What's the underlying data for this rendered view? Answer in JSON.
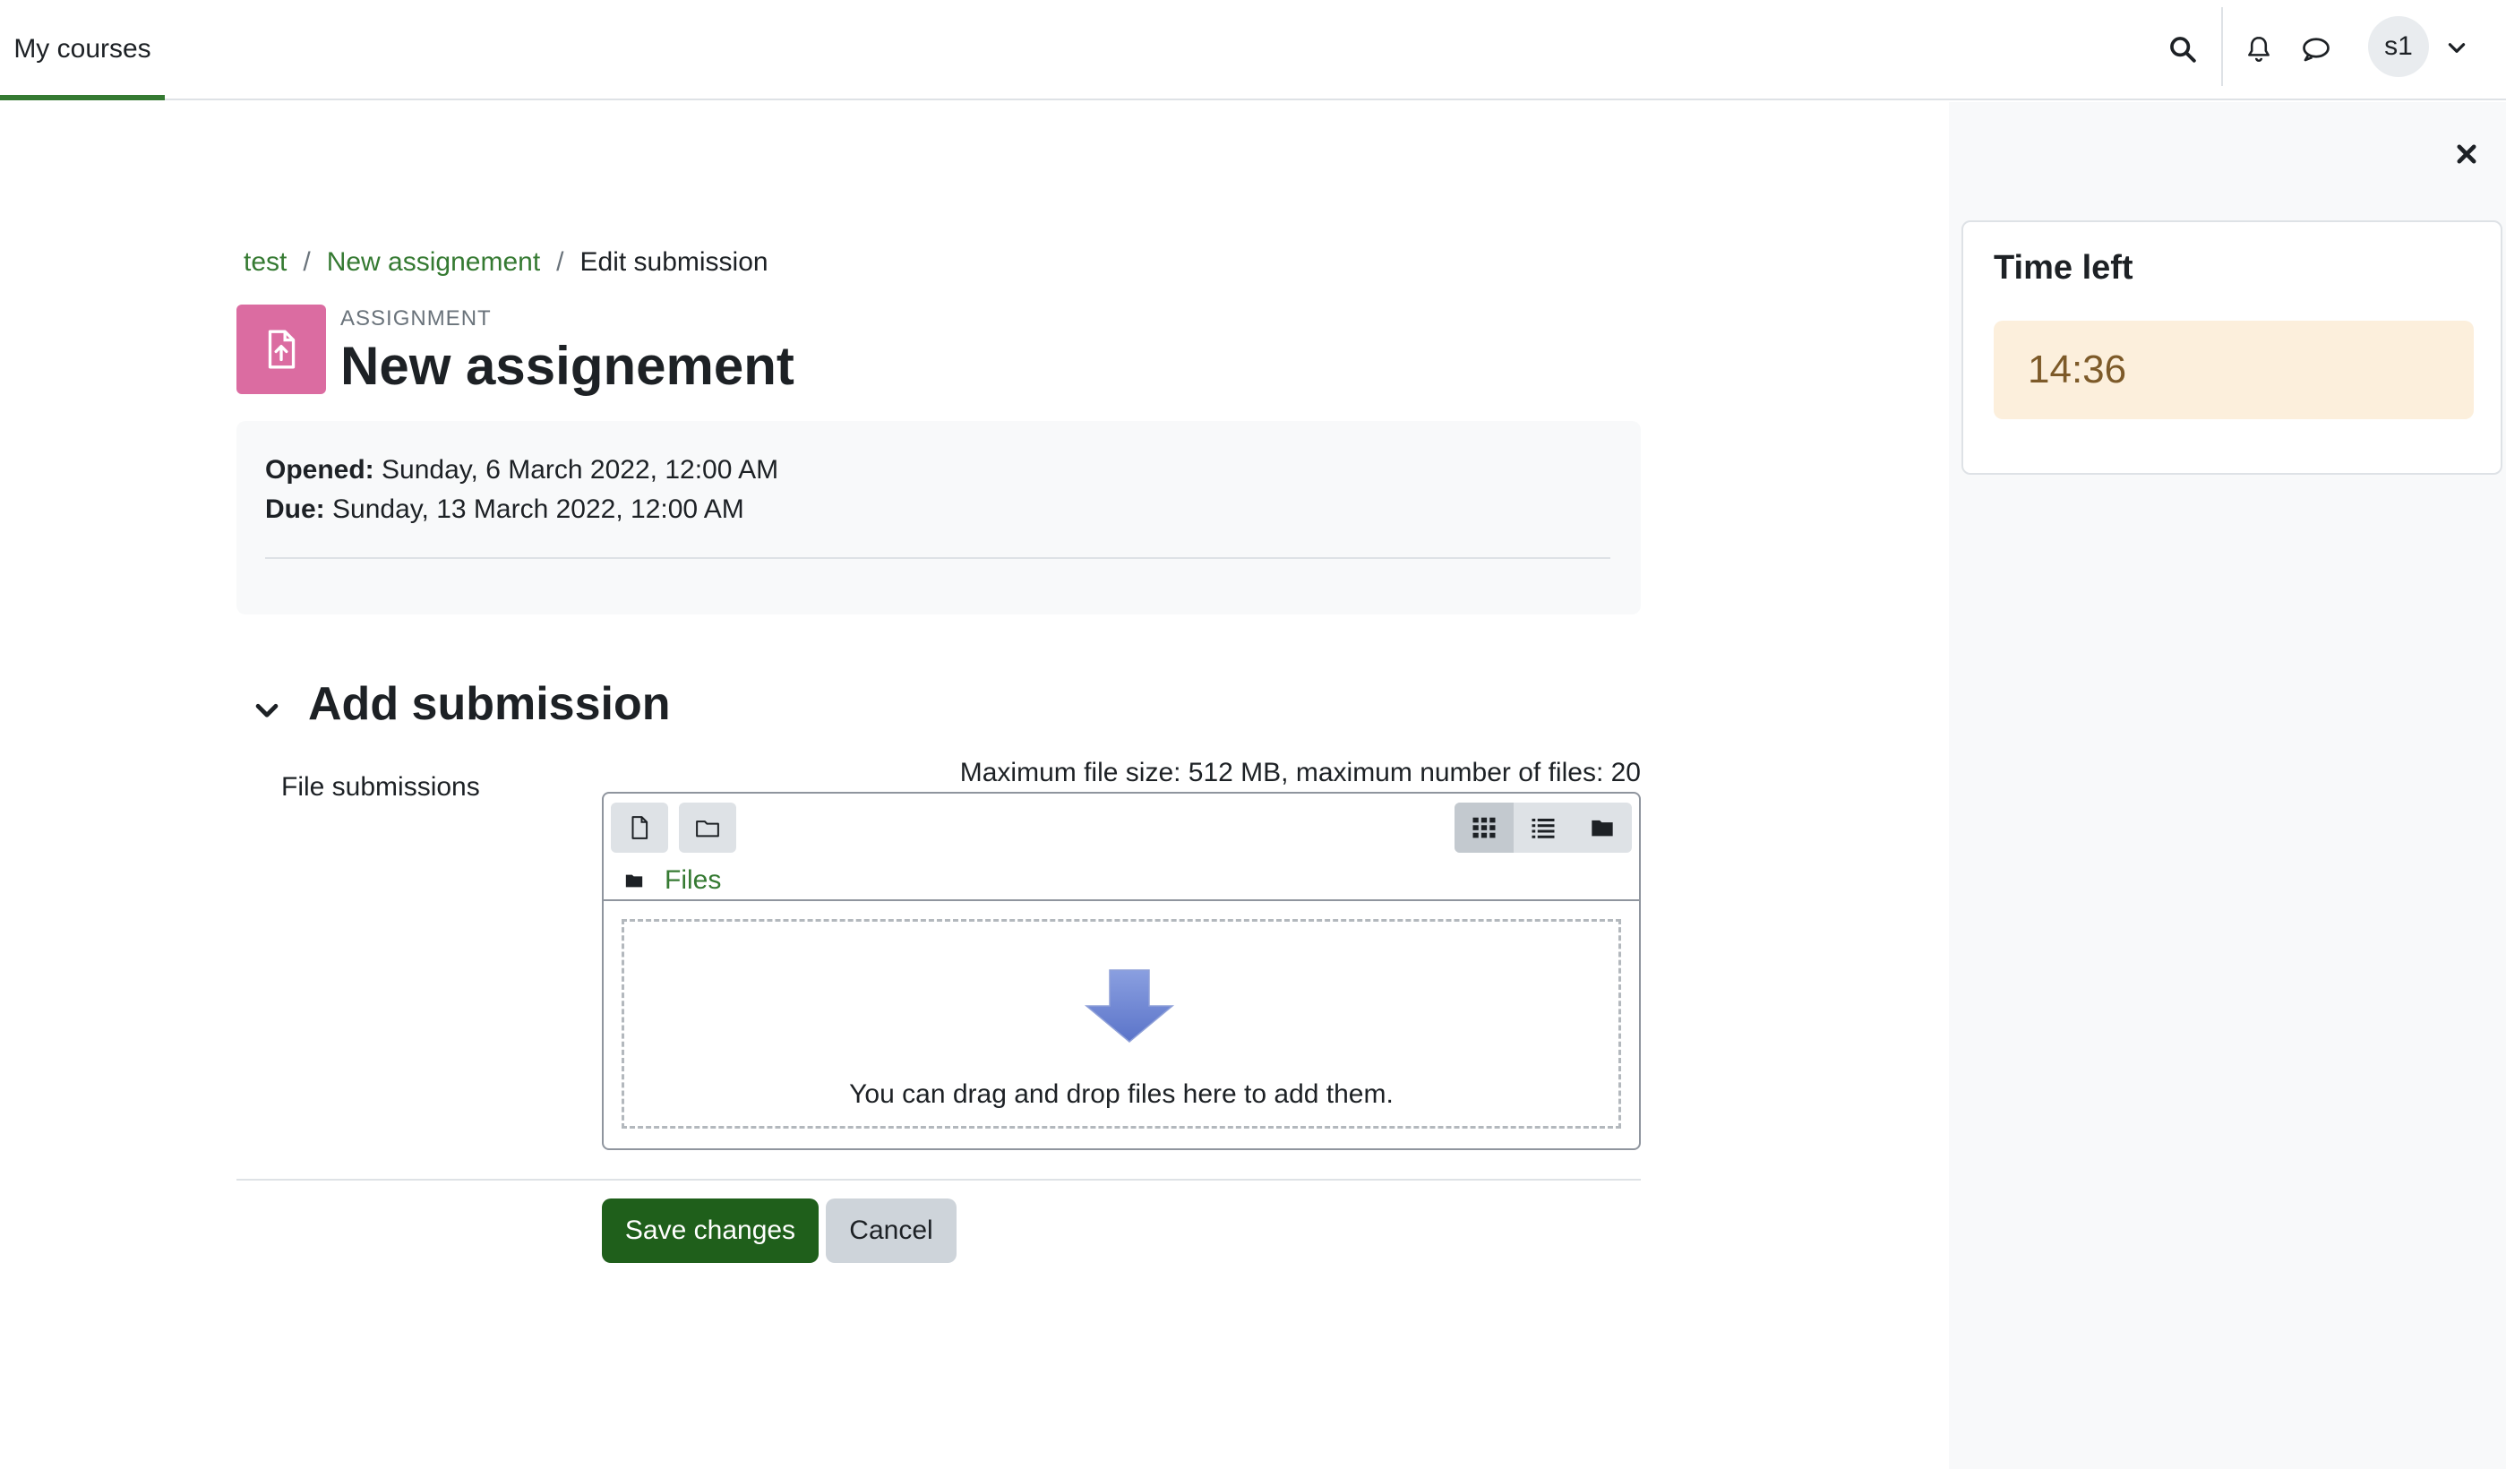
{
  "navbar": {
    "tab_label": "My courses",
    "avatar_initials": "s1",
    "icons": [
      "search-icon",
      "bell-icon",
      "chat-icon",
      "chevron-down-icon"
    ]
  },
  "drawer": {
    "block_title": "Time left",
    "time_left": "14:36"
  },
  "breadcrumb": {
    "items": [
      "test",
      "New assignement",
      "Edit submission"
    ],
    "separator": "/"
  },
  "header": {
    "activity_type": "ASSIGNMENT",
    "title": "New assignement"
  },
  "dates": {
    "opened_label": "Opened:",
    "opened_value": "Sunday, 6 March 2022, 12:00 AM",
    "due_label": "Due:",
    "due_value": "Sunday, 13 March 2022, 12:00 AM"
  },
  "section": {
    "title": "Add submission"
  },
  "file_submissions": {
    "label": "File submissions",
    "limits": "Maximum file size: 512 MB, maximum number of files: 20",
    "path_label": "Files",
    "dropzone_text": "You can drag and drop files here to add them."
  },
  "buttons": {
    "save_label": "Save changes",
    "cancel_label": "Cancel"
  },
  "colors": {
    "brand_green": "#357a32",
    "primary_button": "#1f5f1b",
    "activity_icon": "#d9609a",
    "timer_bg": "#fcefdc",
    "timer_text": "#7d5a29"
  }
}
